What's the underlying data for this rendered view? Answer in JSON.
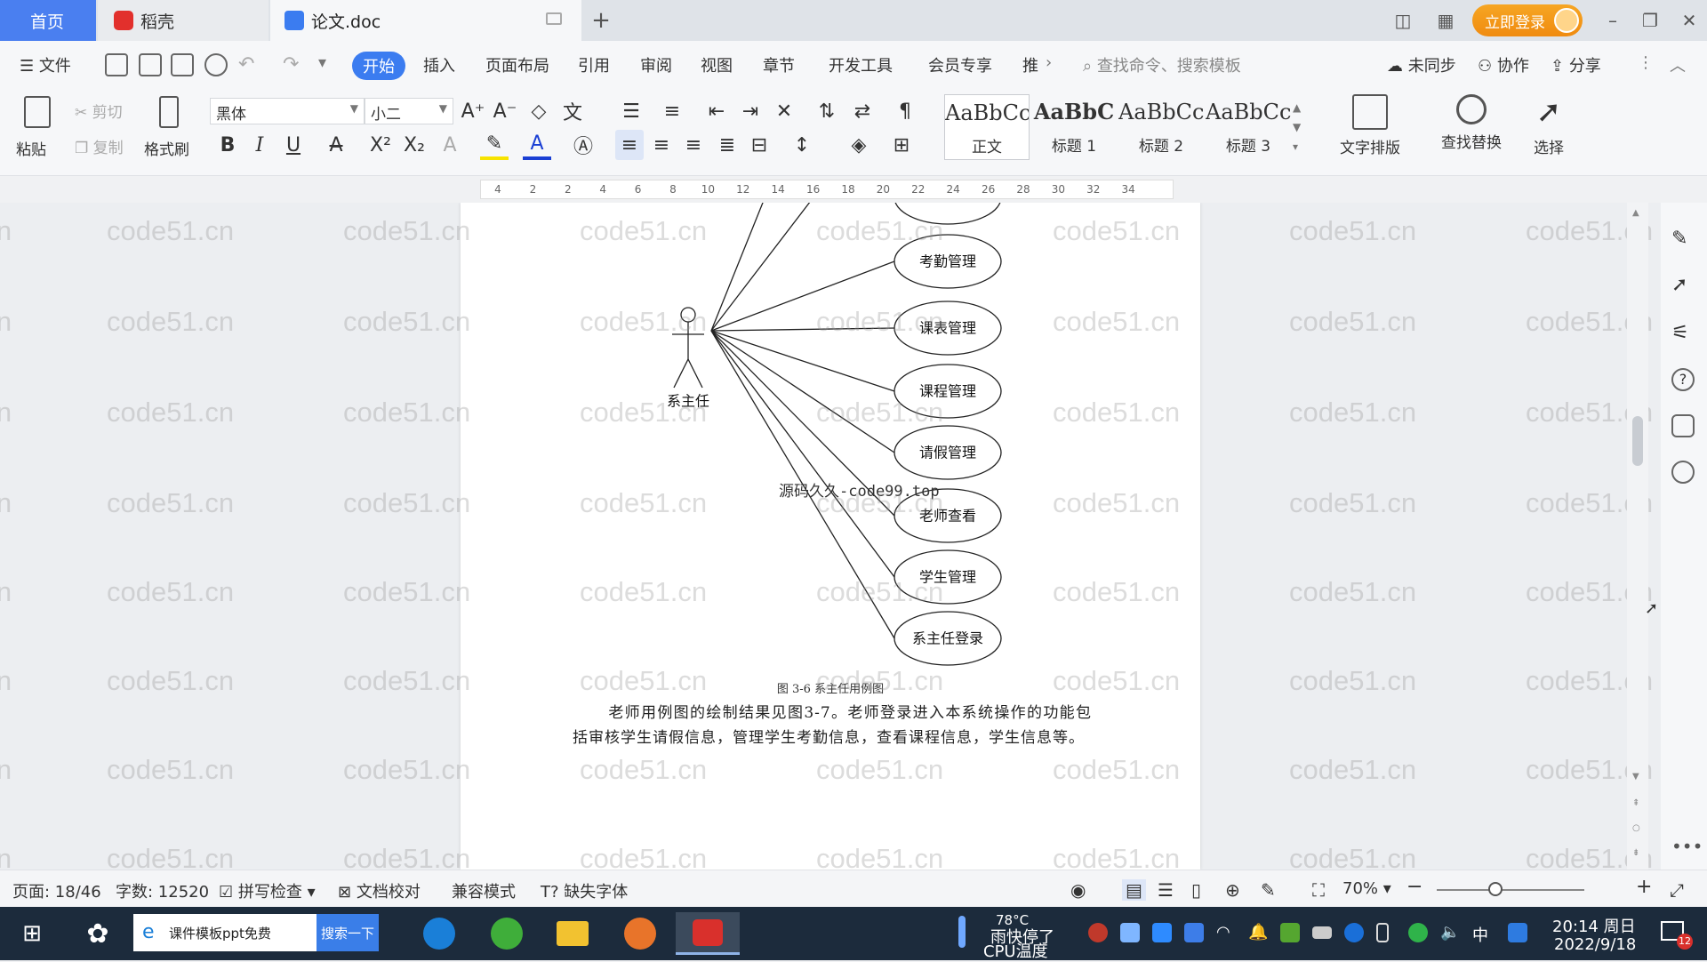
{
  "titlebar": {
    "tab_home": "首页",
    "tab_daoke": "稻壳",
    "tab_doc": "论文.doc",
    "new_tab": "+",
    "login": "立即登录"
  },
  "menu": {
    "file": "文件",
    "start": "开始",
    "items": [
      "插入",
      "页面布局",
      "引用",
      "审阅",
      "视图",
      "章节",
      "开发工具",
      "会员专享",
      "推"
    ],
    "search_cmd": "查找命令、搜索模板",
    "sync": "未同步",
    "collab": "协作",
    "share": "分享"
  },
  "ribbon": {
    "paste": "粘贴",
    "cut": "剪切",
    "copy": "复制",
    "format_painter": "格式刷",
    "font_name": "黑体",
    "font_size": "小二",
    "styles": [
      {
        "sample": "AaBbCcDd",
        "name": "正文"
      },
      {
        "sample": "AaBbC",
        "name": "标题 1"
      },
      {
        "sample": "AaBbCc",
        "name": "标题 2"
      },
      {
        "sample": "AaBbCc",
        "name": "标题 3"
      }
    ],
    "text_layout": "文字排版",
    "find_replace": "查找替换",
    "select": "选择"
  },
  "ruler": {
    "ticks": [
      "4",
      "2",
      "2",
      "4",
      "6",
      "8",
      "10",
      "12",
      "14",
      "16",
      "18",
      "20",
      "22",
      "24",
      "26",
      "28",
      "30",
      "32",
      "34"
    ]
  },
  "document": {
    "actor": "系主任",
    "use_cases": [
      "考勤管理",
      "课表管理",
      "课程管理",
      "请假管理",
      "老师查看",
      "学生管理",
      "系主任登录"
    ],
    "inline_watermark": "源码久久-code99.top",
    "caption": "图 3-6  系主任用例图",
    "paragraph": "老师用例图的绘制结果见图3-7。老师登录进入本系统操作的功能包括审核学生请假信息，管理学生考勤信息，查看课程信息，学生信息等。"
  },
  "watermark": "code51.cn",
  "statusbar": {
    "page": "页面: 18/46",
    "words": "字数: 12520",
    "spell": "拼写检查",
    "proof": "文档校对",
    "compat": "兼容模式",
    "missing_font": "缺失字体",
    "zoom": "70%"
  },
  "taskbar": {
    "search_text": "课件模板ppt免费",
    "search_btn": "搜索一下",
    "weather_temp": "78°C",
    "weather_text": "雨快停了",
    "cpu": "CPU温度",
    "ime": "中",
    "time": "20:14 周日",
    "date": "2022/9/18",
    "notif_count": "12"
  },
  "colors": {
    "accent": "#3b7cf0",
    "login": "#f39a1a",
    "taskbar": "#1c2b3c",
    "wps_red": "#d9302c"
  }
}
